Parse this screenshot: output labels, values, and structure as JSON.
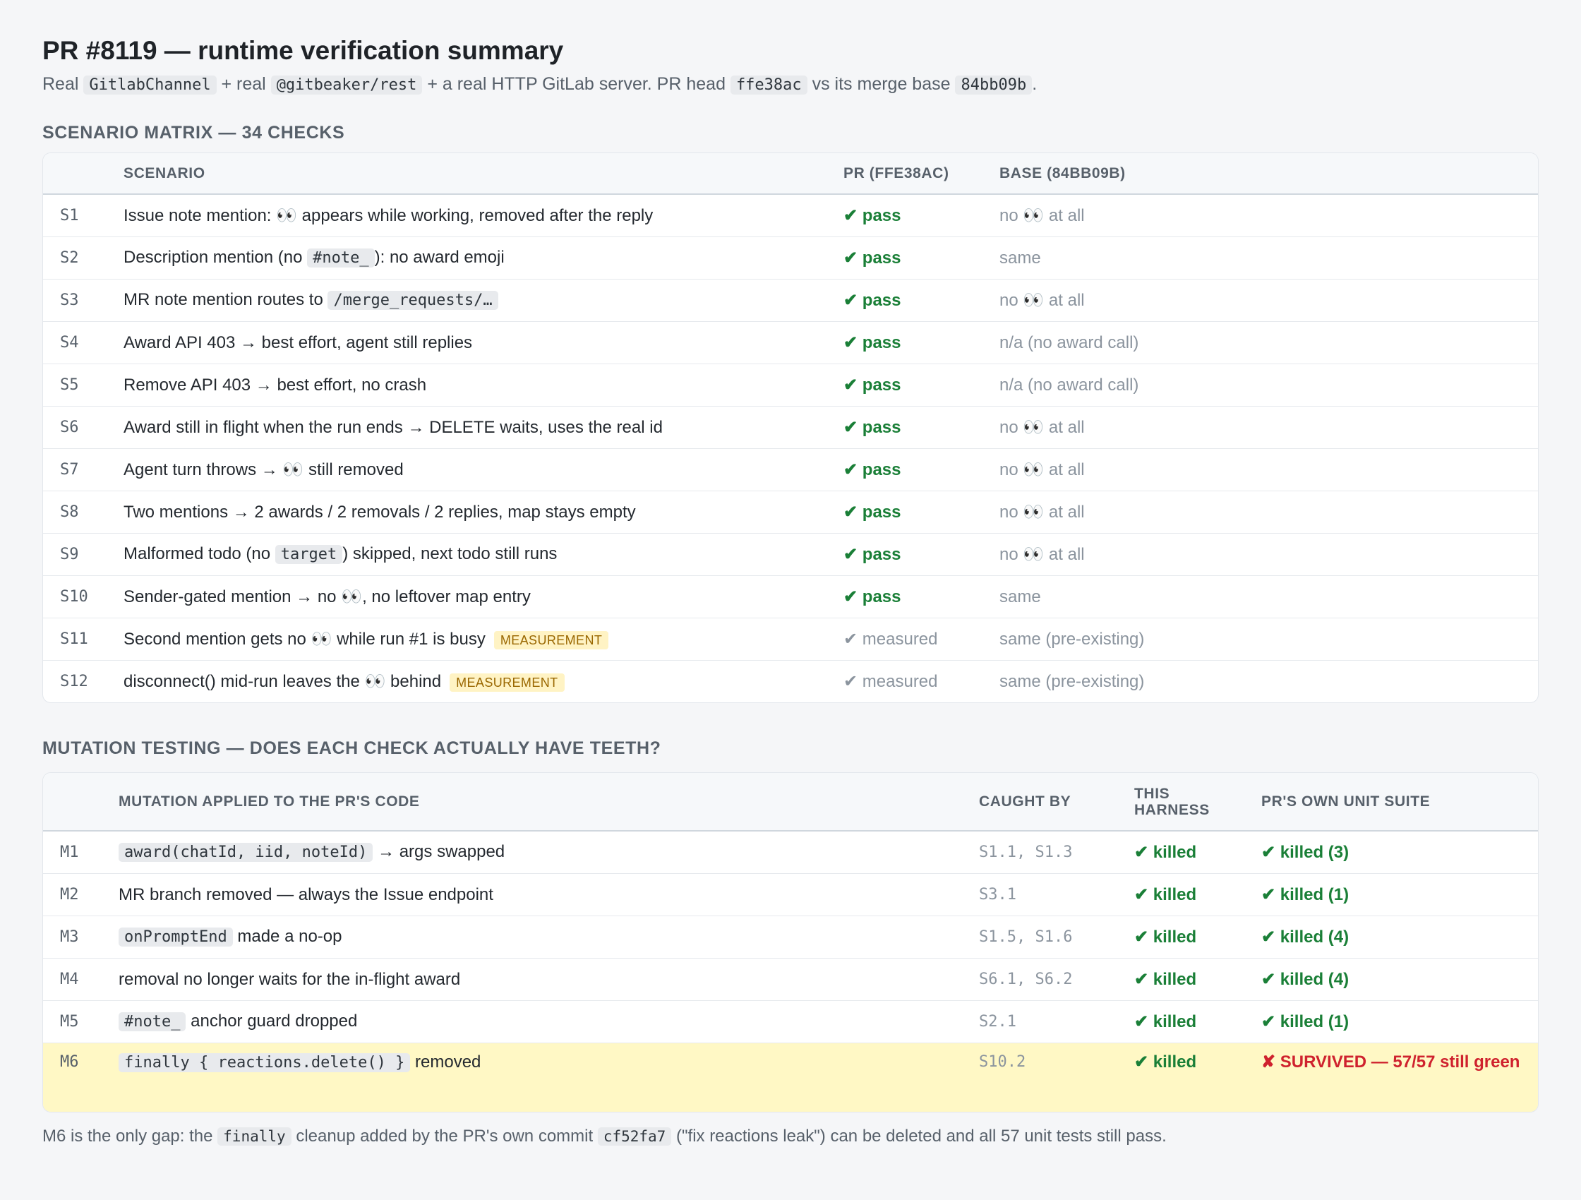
{
  "header": {
    "title": "PR #8119 — runtime verification summary",
    "subtitle": {
      "t1": "Real ",
      "code1": "GitlabChannel",
      "t2": " + real ",
      "code2": "@gitbeaker/rest",
      "t3": " + a real HTTP GitLab server. PR head ",
      "code3": "ffe38ac",
      "t4": " vs its merge base ",
      "code4": "84bb09b",
      "t5": "."
    }
  },
  "scenarios": {
    "title": "SCENARIO MATRIX — 34 CHECKS",
    "columns": {
      "id": "",
      "scenario": "SCENARIO",
      "pr": "PR (FFE38AC)",
      "base": "BASE (84BB09B)"
    },
    "rows": [
      {
        "id": "S1",
        "pre": "Issue note mention: 👀 appears while working, removed after the reply",
        "code": "",
        "post": "",
        "tag": "",
        "pr": "✔ pass",
        "base": "no 👀 at all"
      },
      {
        "id": "S2",
        "pre": "Description mention (no ",
        "code": "#note_",
        "post": "): no award emoji",
        "tag": "",
        "pr": "✔ pass",
        "base": "same"
      },
      {
        "id": "S3",
        "pre": "MR note mention routes to ",
        "code": "/merge_requests/…",
        "post": "",
        "tag": "",
        "pr": "✔ pass",
        "base": "no 👀 at all"
      },
      {
        "id": "S4",
        "pre": "Award API 403 → best effort, agent still replies",
        "code": "",
        "post": "",
        "tag": "",
        "pr": "✔ pass",
        "base": "n/a (no award call)"
      },
      {
        "id": "S5",
        "pre": "Remove API 403 → best effort, no crash",
        "code": "",
        "post": "",
        "tag": "",
        "pr": "✔ pass",
        "base": "n/a (no award call)"
      },
      {
        "id": "S6",
        "pre": "Award still in flight when the run ends → DELETE waits, uses the real id",
        "code": "",
        "post": "",
        "tag": "",
        "pr": "✔ pass",
        "base": "no 👀 at all"
      },
      {
        "id": "S7",
        "pre": "Agent turn throws → 👀 still removed",
        "code": "",
        "post": "",
        "tag": "",
        "pr": "✔ pass",
        "base": "no 👀 at all"
      },
      {
        "id": "S8",
        "pre": "Two mentions → 2 awards / 2 removals / 2 replies, map stays empty",
        "code": "",
        "post": "",
        "tag": "",
        "pr": "✔ pass",
        "base": "no 👀 at all"
      },
      {
        "id": "S9",
        "pre": "Malformed todo (no ",
        "code": "target",
        "post": ") skipped, next todo still runs",
        "tag": "",
        "pr": "✔ pass",
        "base": "no 👀 at all"
      },
      {
        "id": "S10",
        "pre": "Sender-gated mention → no 👀, no leftover map entry",
        "code": "",
        "post": "",
        "tag": "",
        "pr": "✔ pass",
        "base": "same"
      },
      {
        "id": "S11",
        "pre": "Second mention gets no 👀 while run #1 is busy",
        "code": "",
        "post": "",
        "tag": "MEASUREMENT",
        "pr": "✔ measured",
        "base": "same (pre-existing)"
      },
      {
        "id": "S12",
        "pre": "disconnect() mid-run leaves the 👀 behind",
        "code": "",
        "post": "",
        "tag": "MEASUREMENT",
        "pr": "✔ measured",
        "base": "same (pre-existing)"
      }
    ]
  },
  "mutations": {
    "title": "MUTATION TESTING — DOES EACH CHECK ACTUALLY HAVE TEETH?",
    "columns": {
      "id": "",
      "mutation": "MUTATION APPLIED TO THE PR'S CODE",
      "caught": "CAUGHT BY",
      "harness_line1": "THIS",
      "harness_line2": "HARNESS",
      "unit": "PR'S OWN UNIT SUITE"
    },
    "rows": [
      {
        "id": "M1",
        "pre": "",
        "code": "award(chatId, iid, noteId)",
        "post": " → args swapped",
        "caught": "S1.1, S1.3",
        "harness": "✔ killed",
        "unit": "✔ killed (3)",
        "survived": false
      },
      {
        "id": "M2",
        "pre": "MR branch removed — always the Issue endpoint",
        "code": "",
        "post": "",
        "caught": "S3.1",
        "harness": "✔ killed",
        "unit": "✔ killed (1)",
        "survived": false
      },
      {
        "id": "M3",
        "pre": "",
        "code": "onPromptEnd",
        "post": " made a no-op",
        "caught": "S1.5, S1.6",
        "harness": "✔ killed",
        "unit": "✔ killed (4)",
        "survived": false
      },
      {
        "id": "M4",
        "pre": "removal no longer waits for the in-flight award",
        "code": "",
        "post": "",
        "caught": "S6.1, S6.2",
        "harness": "✔ killed",
        "unit": "✔ killed (4)",
        "survived": false
      },
      {
        "id": "M5",
        "pre": "",
        "code": "#note_",
        "post": " anchor guard dropped",
        "caught": "S2.1",
        "harness": "✔ killed",
        "unit": "✔ killed (1)",
        "survived": false
      },
      {
        "id": "M6",
        "pre": "",
        "code": "finally { reactions.delete() }",
        "post": " removed",
        "caught": "S10.2",
        "harness": "✔ killed",
        "unit": "✘ SURVIVED — 57/57 still green",
        "survived": true
      }
    ]
  },
  "footnote": {
    "t1": "M6 is the only gap: the ",
    "code1": "finally",
    "t2": " cleanup added by the PR's own commit ",
    "code2": "cf52fa7",
    "t3": " (\"fix reactions leak\") can be deleted and all 57 unit tests still pass."
  },
  "colors": {
    "pass": "#1a7f37",
    "survived": "#cf222e",
    "highlight_row": "#fff8c5",
    "measurement_tag": "#fff3c4"
  }
}
